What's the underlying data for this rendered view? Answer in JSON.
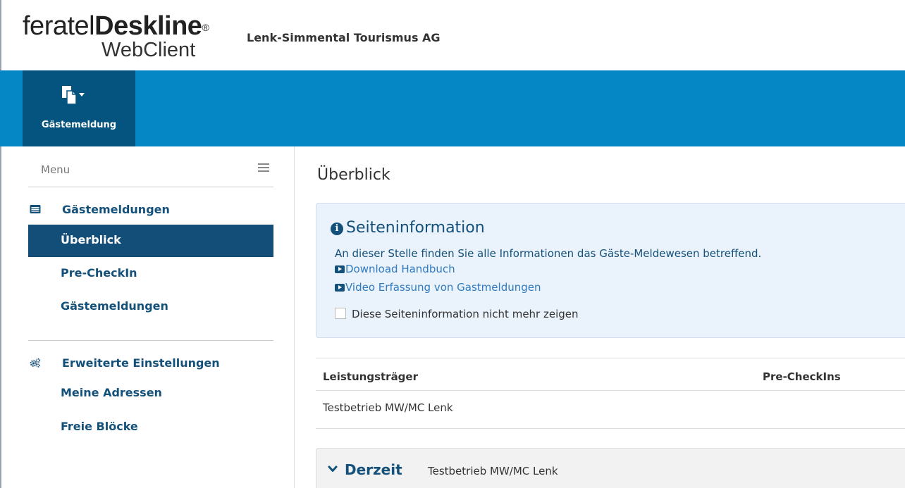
{
  "header": {
    "logo_light": "feratel",
    "logo_bold": "Deskline",
    "logo_reg": "®",
    "logo_sub": "WebClient",
    "company": "Lenk-Simmental Tourismus AG"
  },
  "topnav": {
    "tile_label": "Gästemeldung",
    "tile_icon": "copy-document-dropdown-icon"
  },
  "sidebar": {
    "menu_label": "Menu",
    "group1": {
      "title": "Gästemeldungen",
      "icon": "list-card-icon",
      "items": [
        {
          "label": "Überblick",
          "active": true
        },
        {
          "label": "Pre-CheckIn",
          "active": false
        },
        {
          "label": "Gästemeldungen",
          "active": false
        }
      ]
    },
    "group2": {
      "title": "Erweiterte Einstellungen",
      "icon": "cogs-icon",
      "items": [
        {
          "label": "Meine Adressen"
        },
        {
          "label": "Freie Blöcke"
        }
      ]
    }
  },
  "main": {
    "title": "Überblick",
    "info": {
      "title": "Seiteninformation",
      "icon_glyph": "i",
      "text": "An dieser Stelle finden Sie alle Informationen das Gäste-Meldewesen betreffend.",
      "link1": "Download Handbuch",
      "link2": "Video Erfassung von Gastmeldungen",
      "checkbox_label": "Diese Seiteninformation nicht mehr zeigen",
      "checkbox_checked": false
    },
    "table": {
      "columns": [
        "Leistungsträger",
        "Pre-CheckIns"
      ],
      "rows": [
        [
          "Testbetrieb MW/MC Lenk",
          ""
        ]
      ]
    },
    "derzeit": {
      "title": "Derzeit",
      "subtitle": "Testbetrieb MW/MC Lenk"
    }
  },
  "colors": {
    "brand_blue": "#0587c6",
    "dark_blue": "#05547f",
    "active_item": "#124e78",
    "link_text": "#14517a"
  }
}
